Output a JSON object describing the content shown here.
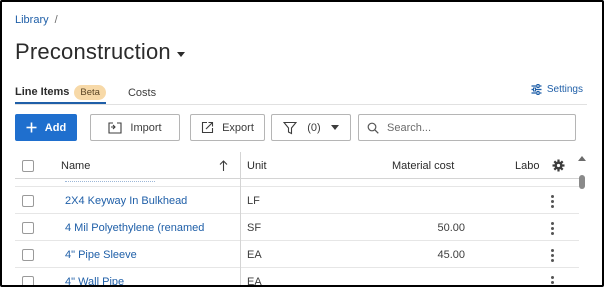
{
  "breadcrumb": {
    "root": "Library",
    "separator": "/"
  },
  "page": {
    "title": "Preconstruction"
  },
  "tabs": [
    {
      "label": "Line Items",
      "badge": "Beta",
      "active": true
    },
    {
      "label": "Costs",
      "active": false
    }
  ],
  "settings": {
    "label": "Settings"
  },
  "toolbar": {
    "add_label": "Add",
    "import_label": "Import",
    "export_label": "Export",
    "filter_count": "(0)",
    "search_placeholder": "Search..."
  },
  "table": {
    "columns": {
      "name": "Name",
      "unit": "Unit",
      "material_cost": "Material cost",
      "labor": "Labo"
    },
    "sort": "ascending",
    "rows": [
      {
        "name": "2X4 Keyway In Bulkhead",
        "unit": "LF",
        "material_cost": ""
      },
      {
        "name": "4 Mil Polyethylene (renamed",
        "unit": "SF",
        "material_cost": "50.00"
      },
      {
        "name": "4\" Pipe Sleeve",
        "unit": "EA",
        "material_cost": "45.00"
      },
      {
        "name": "4\" Wall Pipe",
        "unit": "EA",
        "material_cost": ""
      }
    ]
  },
  "colors": {
    "accent": "#1f6fce",
    "link": "#1f5fa8",
    "badge_bg": "#f7d9a8"
  },
  "icons": [
    "plus-icon",
    "import-icon",
    "export-icon",
    "filter-icon",
    "chevron-down-icon",
    "search-icon",
    "settings-sliders-icon",
    "gear-icon",
    "sort-arrow-up-icon",
    "kebab-menu-icon"
  ]
}
